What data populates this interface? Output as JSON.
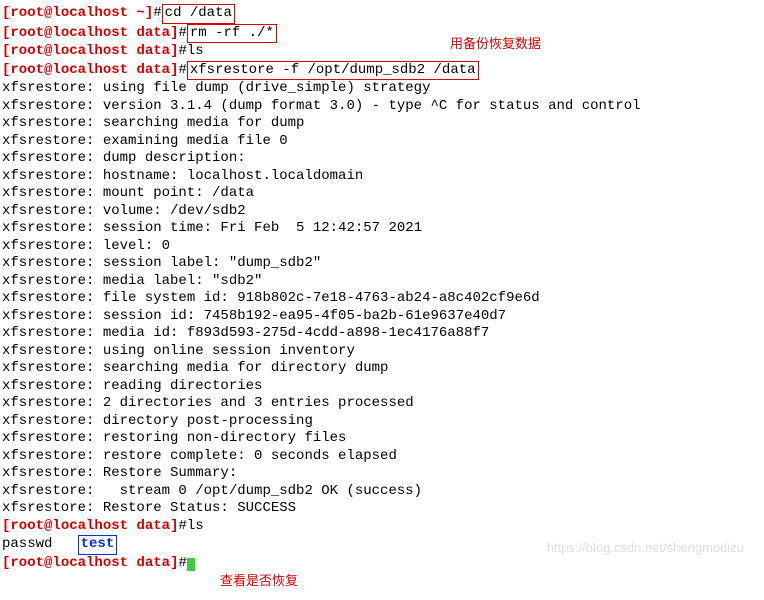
{
  "prompts": {
    "p1": {
      "open": "[",
      "user": "root",
      "at": "@",
      "host": "localhost",
      "sep": " ",
      "path": "~",
      "close": "]",
      "hash": "#"
    },
    "p2": {
      "open": "[",
      "user": "root",
      "at": "@",
      "host": "localhost",
      "sep": " ",
      "path": "data",
      "close": "]",
      "hash": "#"
    }
  },
  "cmds": {
    "cd": "cd /data",
    "rm": "rm -rf ./*",
    "ls": "ls",
    "restore": "xfsrestore -f /opt/dump_sdb2 /data"
  },
  "output": {
    "l1": "xfsrestore: using file dump (drive_simple) strategy",
    "l2": "xfsrestore: version 3.1.4 (dump format 3.0) - type ^C for status and control",
    "l3": "xfsrestore: searching media for dump",
    "l4": "xfsrestore: examining media file 0",
    "l5": "xfsrestore: dump description:",
    "l6": "xfsrestore: hostname: localhost.localdomain",
    "l7": "xfsrestore: mount point: /data",
    "l8": "xfsrestore: volume: /dev/sdb2",
    "l9": "xfsrestore: session time: Fri Feb  5 12:42:57 2021",
    "l10": "xfsrestore: level: 0",
    "l11": "xfsrestore: session label: \"dump_sdb2\"",
    "l12": "xfsrestore: media label: \"sdb2\"",
    "l13": "xfsrestore: file system id: 918b802c-7e18-4763-ab24-a8c402cf9e6d",
    "l14": "xfsrestore: session id: 7458b192-ea95-4f05-ba2b-61e9637e40d7",
    "l15": "xfsrestore: media id: f893d593-275d-4cdd-a898-1ec4176a88f7",
    "l16": "xfsrestore: using online session inventory",
    "l17": "xfsrestore: searching media for directory dump",
    "l18": "xfsrestore: reading directories",
    "l19": "xfsrestore: 2 directories and 3 entries processed",
    "l20": "xfsrestore: directory post-processing",
    "l21": "xfsrestore: restoring non-directory files",
    "l22": "xfsrestore: restore complete: 0 seconds elapsed",
    "l23": "xfsrestore: Restore Summary:",
    "l24": "xfsrestore:   stream 0 /opt/dump_sdb2 OK (success)",
    "l25": "xfsrestore: Restore Status: SUCCESS"
  },
  "ls_out": {
    "passwd": "passwd   ",
    "test": "test"
  },
  "annotations": {
    "a1": "用备份恢复数据",
    "a2": "查看是否恢复"
  },
  "watermark": "https://blog.csdn.net/shengmodizu"
}
